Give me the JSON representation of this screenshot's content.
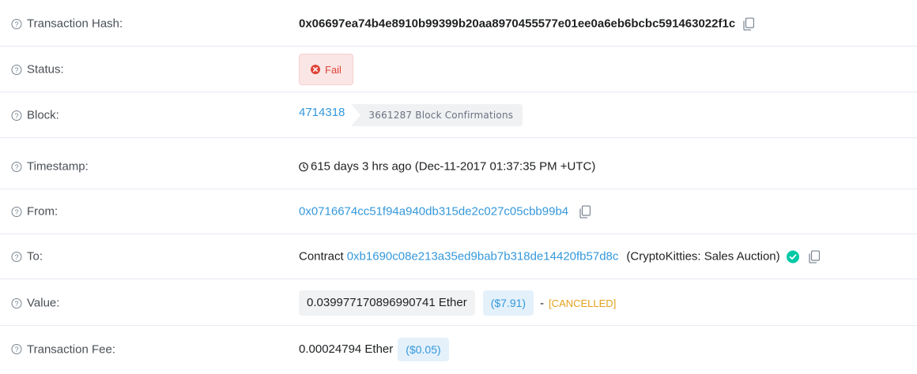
{
  "rows": {
    "tx_hash": {
      "label": "Transaction Hash:",
      "value": "0x06697ea74b4e8910b99399b20aa8970455577e01ee0a6eb6bcbc591463022f1c"
    },
    "status": {
      "label": "Status:",
      "value": "Fail"
    },
    "block": {
      "label": "Block:",
      "number": "4714318",
      "confirmations": "3661287 Block Confirmations"
    },
    "timestamp": {
      "label": "Timestamp:",
      "value": "615 days 3 hrs ago (Dec-11-2017 01:37:35 PM +UTC)"
    },
    "from": {
      "label": "From:",
      "address": "0x0716674cc51f94a940db315de2c027c05cbb99b4"
    },
    "to": {
      "label": "To:",
      "prefix": "Contract",
      "address": "0xb1690c08e213a35ed9bab7b318de14420fb57d8c",
      "name": "(CryptoKitties: Sales Auction)"
    },
    "value": {
      "label": "Value:",
      "ether": "0.039977170896990741 Ether",
      "usd": "($7.91)",
      "dash": "-",
      "note": "[CANCELLED]"
    },
    "fee": {
      "label": "Transaction Fee:",
      "ether": "0.00024794 Ether",
      "usd": "($0.05)"
    }
  },
  "icons": {
    "help": "question-circle-icon",
    "copy": "copy-icon",
    "fail": "times-circle-icon",
    "clock": "clock-icon",
    "verified": "check-circle-icon"
  },
  "colors": {
    "link": "#3498db",
    "fail_text": "#de4437",
    "fail_bg": "#fbe6e6",
    "verified": "#00c9a7",
    "cancelled": "#e4a11b"
  }
}
